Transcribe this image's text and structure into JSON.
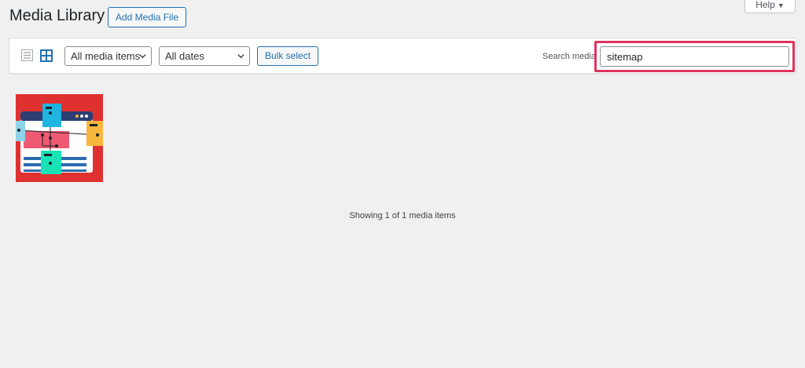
{
  "header": {
    "title": "Media Library",
    "add_button": "Add Media File",
    "help": "Help"
  },
  "toolbar": {
    "view_modes": [
      "list-view-icon",
      "grid-view-icon"
    ],
    "active_view": "grid",
    "type_filter": {
      "selected": "All media items"
    },
    "date_filter": {
      "selected": "All dates"
    },
    "bulk_select": "Bulk select",
    "search_label": "Search media",
    "search_value": "sitemap"
  },
  "media": {
    "items": [
      {
        "icon": "sitemap-illustration"
      }
    ],
    "status": "Showing 1 of 1 media items"
  },
  "colors": {
    "accent": "#2271b1",
    "highlight": "#e0325d",
    "background": "#f0f0f1"
  }
}
